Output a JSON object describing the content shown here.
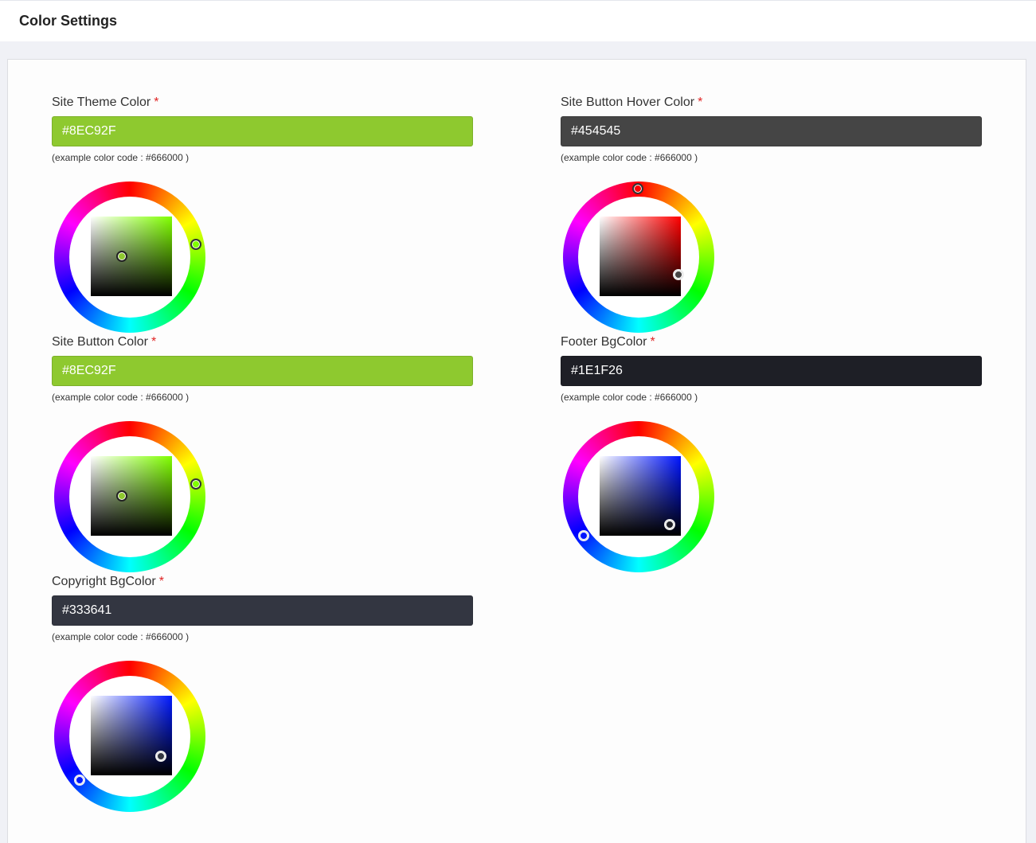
{
  "header": {
    "title": "Color Settings"
  },
  "fields": {
    "site_theme": {
      "label": "Site Theme Color",
      "required_mark": "*",
      "value": "#8EC92F",
      "hint": "(example color code : #666000 )",
      "bg": "#8ec92f",
      "hue_color": "#80ff00"
    },
    "site_button_hover": {
      "label": "Site Button Hover Color",
      "required_mark": "*",
      "value": "#454545",
      "hint": "(example color code : #666000 )",
      "bg": "#454545",
      "hue_color": "#ff0000"
    },
    "site_button": {
      "label": "Site Button Color",
      "required_mark": "*",
      "value": "#8EC92F",
      "hint": "(example color code : #666000 )",
      "bg": "#8ec92f",
      "hue_color": "#80ff00"
    },
    "footer_bg": {
      "label": "Footer BgColor",
      "required_mark": "*",
      "value": "#1E1F26",
      "hint": "(example color code : #666000 )",
      "bg": "#1e1f26",
      "hue_color": "#0015ff"
    },
    "copyright_bg": {
      "label": "Copyright BgColor",
      "required_mark": "*",
      "value": "#333641",
      "hint": "(example color code : #666000 )",
      "bg": "#333641",
      "hue_color": "#0019ff"
    }
  }
}
